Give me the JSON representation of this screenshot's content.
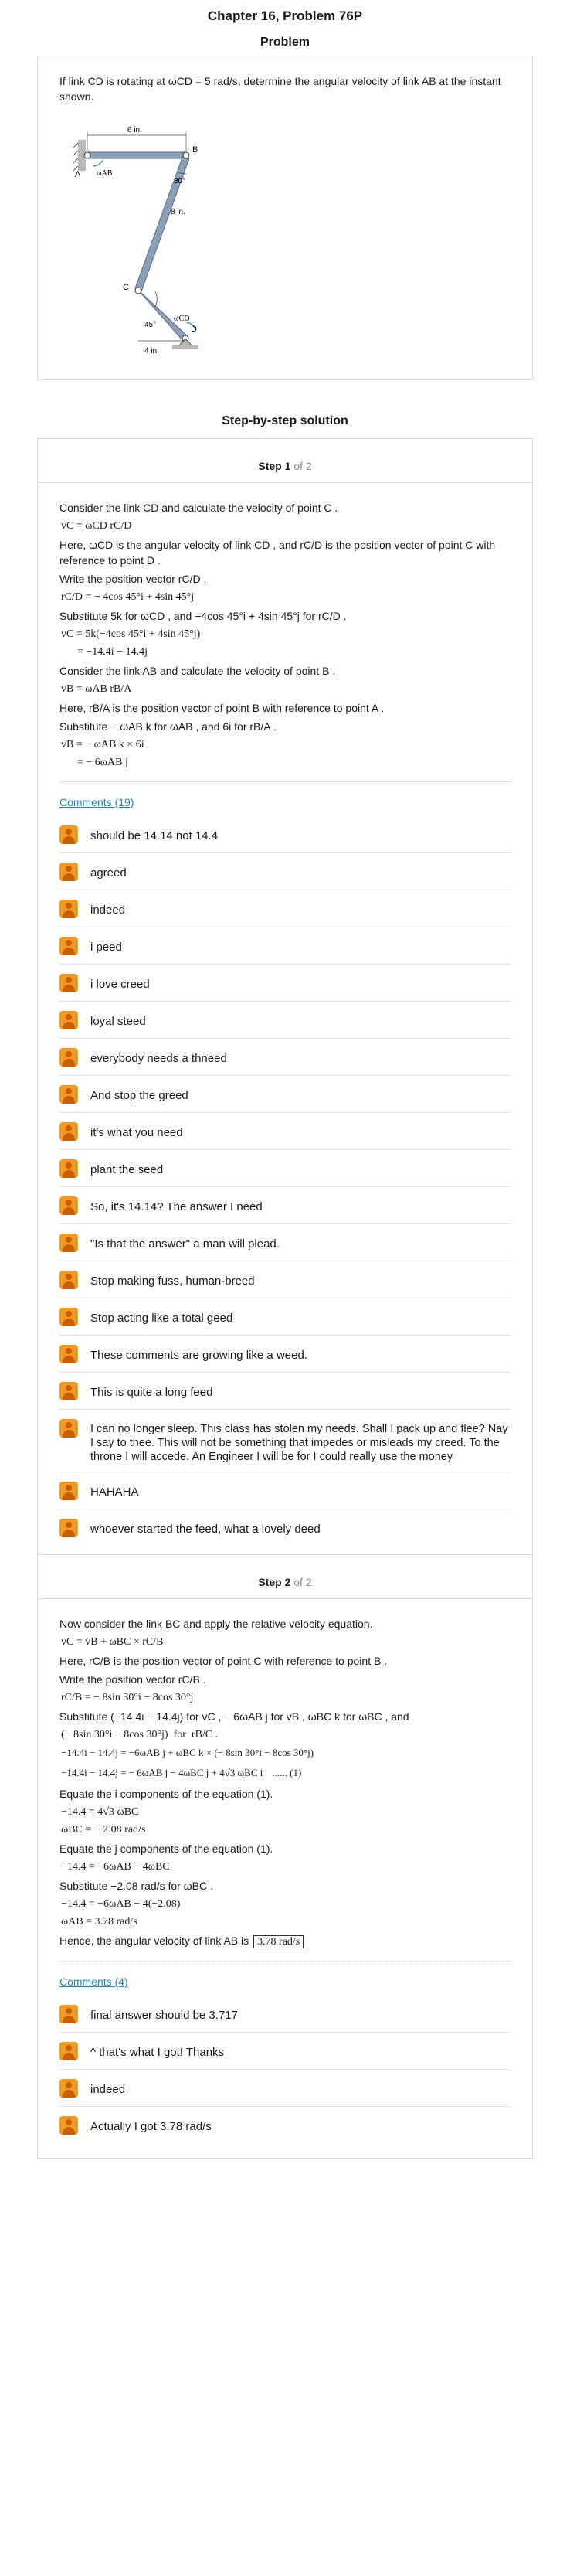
{
  "header": {
    "chapter_title": "Chapter 16, Problem 76P",
    "problem_heading": "Problem",
    "solution_heading": "Step-by-step solution"
  },
  "problem": {
    "text": "If link CD is rotating at ωCD = 5 rad/s, determine the angular velocity of link AB at the instant shown.",
    "figure": {
      "label_6in": "6 in.",
      "label_B": "B",
      "label_A": "A",
      "label_wab": "ωAB",
      "label_30": "30°",
      "label_8in": "8 in.",
      "label_C": "C",
      "label_wcd": "ωCD",
      "label_45": "45°",
      "label_D": "D",
      "label_4in": "4 in."
    }
  },
  "step1": {
    "title_step": "Step 1",
    "title_of": " of 2",
    "lines": [
      "Consider the link  CD  and calculate the velocity of point  C .",
      "vC = ωCD rC/D",
      "Here,  ωCD is the angular velocity of link  CD , and  rC/D is the position vector of point  C  with reference to point  D .",
      "Write the position vector  rC/D .",
      "rC/D = − 4cos 45°i + 4sin 45°j",
      "Substitute  5k  for  ωCD , and  −4cos 45°i + 4sin 45°j  for  rC/D .",
      "vC = 5k(−4cos 45°i + 4sin 45°j)",
      "      = −14.4i − 14.4j",
      "Consider the link  AB  and calculate the velocity of point  B .",
      "vB = ωAB rB/A",
      "Here,  rB/A is the position vector of point  B  with reference to point  A .",
      "Substitute  − ωAB k  for  ωAB , and  6i for  rB/A .",
      "vB = − ωAB k × 6i",
      "      = − 6ωAB j"
    ],
    "comments_link": "Comments (19)",
    "comments": [
      "should be 14.14 not 14.4",
      "agreed",
      "indeed",
      "i peed",
      "i love creed",
      "loyal steed",
      "everybody needs a thneed",
      "And stop the greed",
      "it's what you need",
      "plant the seed",
      "So, it's 14.14? The answer I need",
      "\"Is that the answer\" a man will plead.",
      "Stop making fuss, human-breed",
      "Stop acting like a total geed",
      "These comments are growing like a weed.",
      "This is quite a long feed",
      "I can no longer sleep. This class has stolen my needs. Shall I pack up and flee? Nay I say to thee. This will not be something that impedes or misleads my creed. To the throne I will accede. An Engineer I will be for I could really use the money",
      "HAHAHA",
      "whoever started the feed, what a lovely deed"
    ]
  },
  "step2": {
    "title_step": "Step 2",
    "title_of": " of 2",
    "lines": [
      "Now consider the link  BC  and apply the relative velocity equation.",
      "vC = vB + ωBC × rC/B",
      "Here,  rC/B is the position vector of point  C  with reference to point  B .",
      "Write the position vector  rC/B .",
      "rC/B = − 8sin 30°i − 8cos 30°j",
      "Substitute  (−14.4i − 14.4j) for  vC ,  − 6ωAB j  for  vB ,  ωBC k  for  ωBC , and",
      "(− 8sin 30°i − 8cos 30°j)  for  rB/C .",
      "−14.4i − 14.4j = −6ωAB j + ωBC k × (− 8sin 30°i − 8cos 30°j)",
      "−14.4i − 14.4j = − 6ωAB j − 4ωBC j + 4√3 ωBC i",
      "...... (1)",
      "Equate the  i  components of the equation (1).",
      "−14.4 = 4√3 ωBC",
      "ωBC = − 2.08 rad/s",
      "Equate the  j  components of the equation (1).",
      "−14.4 = −6ωAB − 4ωBC",
      "Substitute  −2.08 rad/s  for  ωBC .",
      "−14.4 = −6ωAB − 4(−2.08)",
      "ωAB = 3.78 rad/s",
      "Hence, the angular velocity of link  AB  is ",
      "3.78 rad/s"
    ],
    "comments_link": "Comments (4)",
    "comments": [
      "final answer should be 3.717",
      "^ that's what I got! Thanks",
      "indeed",
      "Actually I got 3.78 rad/s"
    ]
  },
  "colors": {
    "link": "#1a87c8",
    "avatar": "#f29a22",
    "border": "#d9d9d9"
  }
}
